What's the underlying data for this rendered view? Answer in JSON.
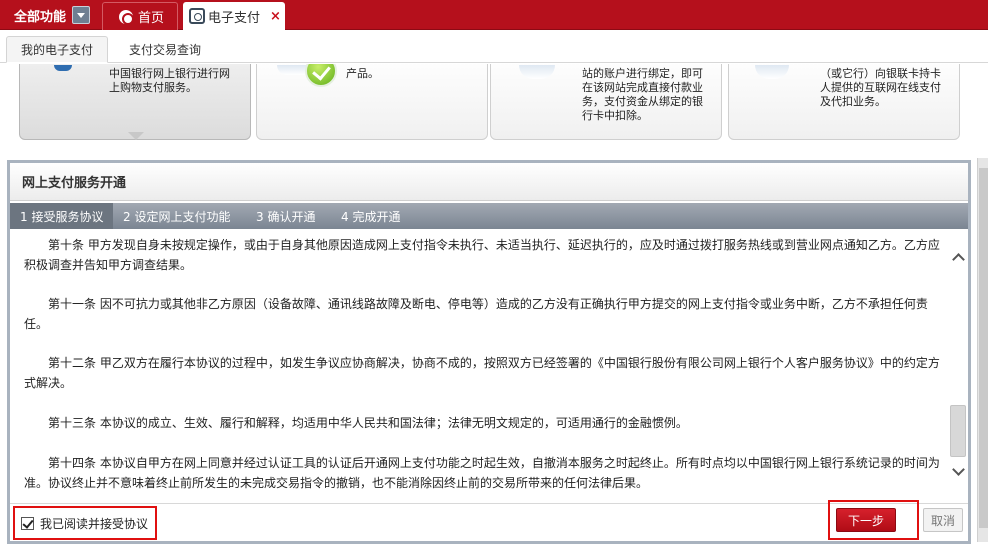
{
  "topbar": {
    "all_functions": "全部功能",
    "tabs": [
      {
        "label": "首页"
      },
      {
        "label": "电子支付",
        "close": "×"
      }
    ]
  },
  "subtabs": [
    {
      "label": "我的电子支付"
    },
    {
      "label": "支付交易查询"
    }
  ],
  "cards": [
    {
      "text_lines": [
        "中国银行网上银行进行网",
        "上购物支付服务。"
      ]
    },
    {
      "text_lines": [
        "产品。"
      ]
    },
    {
      "text_lines": [
        "站的账户进行绑定，即可",
        "在该网站完成直接付款业",
        "务，支付资金从绑定的银",
        "行卡中扣除。"
      ]
    },
    {
      "text_lines": [
        "（或它行）向银联卡持卡",
        "人提供的互联网在线支付",
        "及代扣业务。"
      ]
    }
  ],
  "panel": {
    "title": "网上支付服务开通",
    "steps": [
      "1 接受服务协议",
      "2 设定网上支付功能",
      "3 确认开通",
      "4 完成开通"
    ],
    "paragraphs": [
      "第十条 甲方发现自身未按规定操作，或由于自身其他原因造成网上支付指令未执行、未适当执行、延迟执行的，应及时通过拨打服务热线或到营业网点通知乙方。乙方应积极调查并告知甲方调查结果。",
      "第十一条 因不可抗力或其他非乙方原因（设备故障、通讯线路故障及断电、停电等）造成的乙方没有正确执行甲方提交的网上支付指令或业务中断，乙方不承担任何责任。",
      "第十二条 甲乙双方在履行本协议的过程中，如发生争议应协商解决，协商不成的，按照双方已经签署的《中国银行股份有限公司网上银行个人客户服务协议》中的约定方式解决。",
      "第十三条 本协议的成立、生效、履行和解释，均适用中华人民共和国法律；法律无明文规定的，可适用通行的金融惯例。",
      "第十四条 本协议自甲方在网上同意并经过认证工具的认证后开通网上支付功能之时起生效，自撤消本服务之时起终止。所有时点均以中国银行网上银行系统记录的时间为准。协议终止并不意味着终止前所发生的未完成交易指令的撤销，也不能消除因终止前的交易所带来的任何法律后果。"
    ],
    "agree_label": "我已阅读并接受协议",
    "agree_checked": true,
    "next_label": "下一步",
    "cancel_label": "取消"
  },
  "colors": {
    "brand_red": "#b5101c",
    "highlight_border": "#e01010",
    "panel_border": "#a9b3bf"
  }
}
